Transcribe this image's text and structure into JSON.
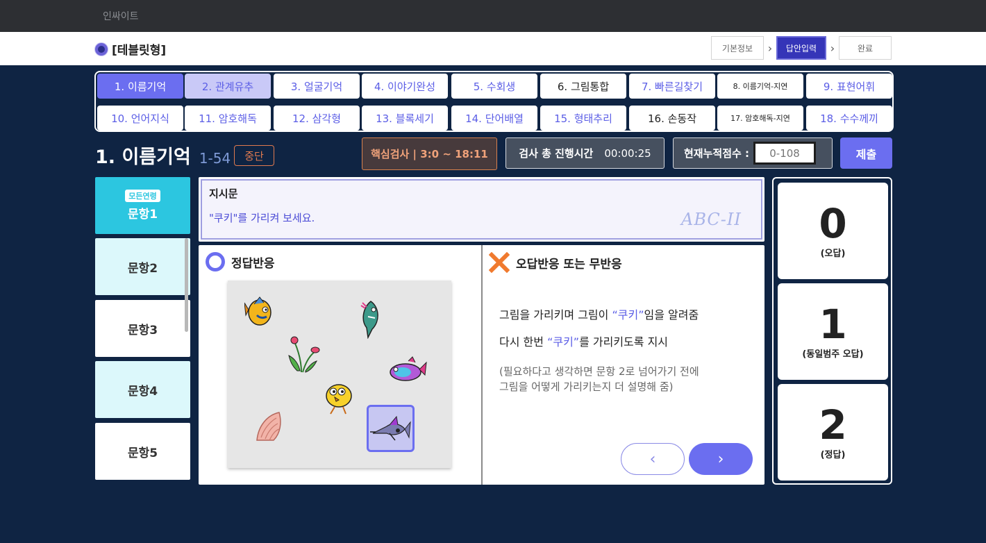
{
  "app": {
    "brand": "인싸이트",
    "page_title": "[테블릿형]"
  },
  "steps": [
    {
      "label": "기본정보",
      "active": false
    },
    {
      "label": "답안입력",
      "active": true
    },
    {
      "label": "완료",
      "active": false
    }
  ],
  "subtests": [
    "1. 이름기억",
    "2. 관계유추",
    "3. 얼굴기억",
    "4. 이야기완성",
    "5. 수회생",
    "6. 그림통합",
    "7. 빠른길찾기",
    "8. 이름기억-지연",
    "9. 표현어휘",
    "10. 언어지식",
    "11. 암호해독",
    "12. 삼각형",
    "13. 블록세기",
    "14. 단어배열",
    "15. 형태추리",
    "16. 손동작",
    "17. 암호해독-지연",
    "18. 수수께끼"
  ],
  "test": {
    "name": "1. 이름기억",
    "range": "1-54",
    "stop_label": "중단",
    "core_label": "핵심검사 | 3:0 ~ 18:11",
    "time_label": "검사 총 진행시간",
    "time_value": "00:00:25",
    "score_label": "현재누적점수 :",
    "score_placeholder": "0-108",
    "submit_label": "제출"
  },
  "items": [
    {
      "label": "문항1",
      "badge": "모든연령",
      "state": "active"
    },
    {
      "label": "문항2",
      "badge": "",
      "state": "light"
    },
    {
      "label": "문항3",
      "badge": "",
      "state": "white"
    },
    {
      "label": "문항4",
      "badge": "",
      "state": "light"
    },
    {
      "label": "문항5",
      "badge": "",
      "state": "white"
    }
  ],
  "instruction": {
    "title": "지시문",
    "text": "\"쿠키\"를 가리켜 보세요.",
    "logo": "ABC-II"
  },
  "correct": {
    "label": "정답반응",
    "pictures": [
      "fish-icon",
      "shark-icon",
      "plant-icon",
      "pufferfish-icon",
      "chick-icon",
      "shell-icon",
      "swordfish-icon"
    ],
    "target": "swordfish-icon"
  },
  "wrong": {
    "label": "오답반응 또는 무반응",
    "line1_pre": "그림을 가리키며 그림이 ",
    "line1_kw": "“쿠키”",
    "line1_post": "임을 알려줌",
    "line2_pre": "다시 한번 ",
    "line2_kw": "“쿠키”",
    "line2_post": "를 가리키도록 지시",
    "note1": "(필요하다고 생각하면 문항 2로 넘어가기 전에",
    "note2": "그림을 어떻게 가리키는지 더 설명해 줌)"
  },
  "score_options": [
    {
      "value": "0",
      "desc": "(오답)"
    },
    {
      "value": "1",
      "desc": "(동일범주 오답)"
    },
    {
      "value": "2",
      "desc": "(정답)"
    }
  ],
  "colors": {
    "accent": "#6b6ef0",
    "item_active": "#2cc6e0",
    "background": "#0f2443"
  }
}
